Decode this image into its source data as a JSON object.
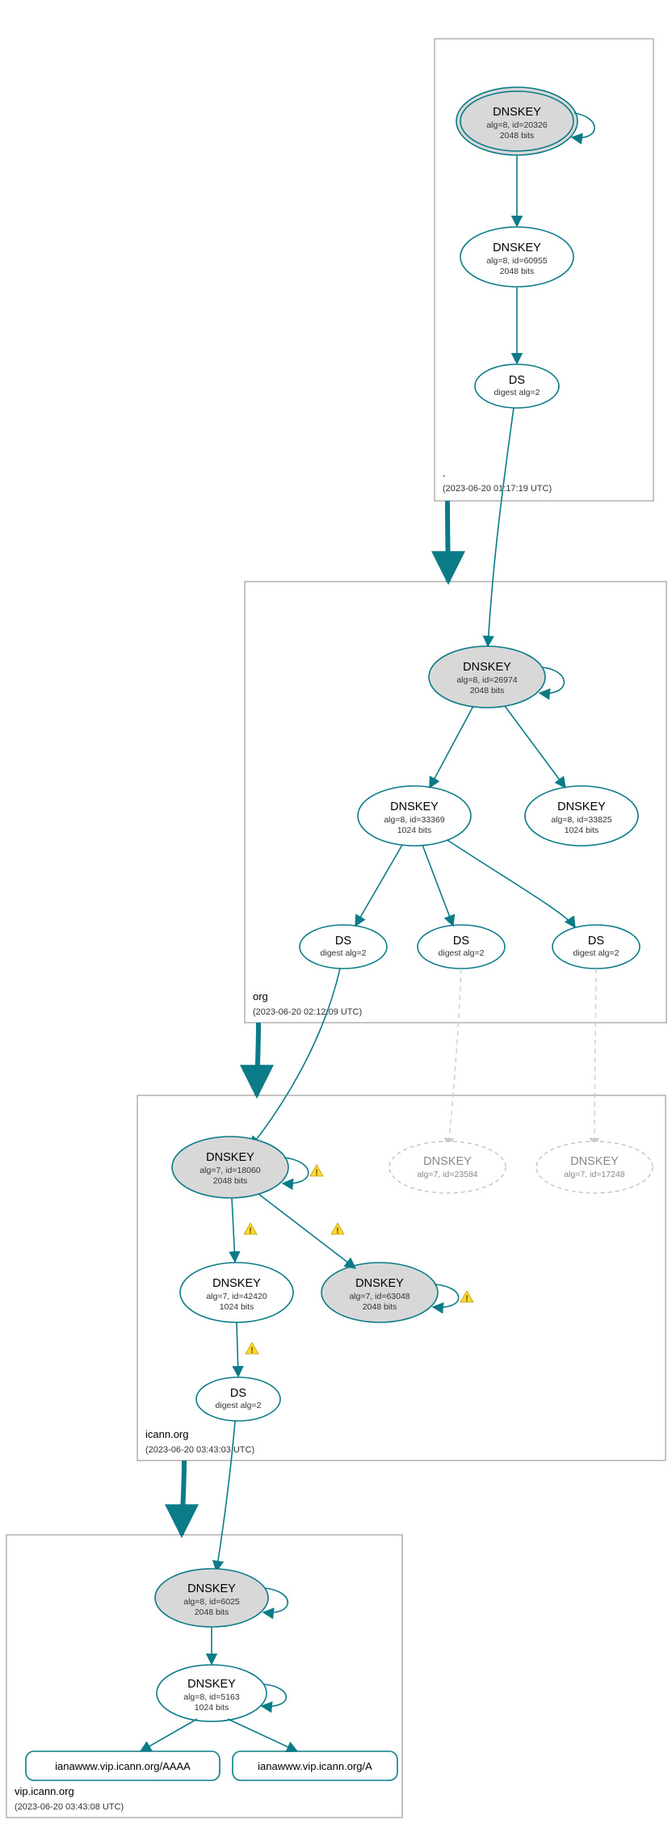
{
  "diagram_type": "DNSSEC authentication chain",
  "zones": {
    "root": {
      "label": ".",
      "timestamp": "(2023-06-20 01:17:19 UTC)",
      "nodes": {
        "ksk": {
          "title": "DNSKEY",
          "line2": "alg=8, id=20326",
          "line3": "2048 bits"
        },
        "zsk": {
          "title": "DNSKEY",
          "line2": "alg=8, id=60955",
          "line3": "2048 bits"
        },
        "ds_org": {
          "title": "DS",
          "line2": "digest alg=2"
        }
      }
    },
    "org": {
      "label": "org",
      "timestamp": "(2023-06-20 02:12:09 UTC)",
      "nodes": {
        "ksk": {
          "title": "DNSKEY",
          "line2": "alg=8, id=26974",
          "line3": "2048 bits"
        },
        "zsk1": {
          "title": "DNSKEY",
          "line2": "alg=8, id=33369",
          "line3": "1024 bits"
        },
        "zsk2": {
          "title": "DNSKEY",
          "line2": "alg=8, id=33825",
          "line3": "1024 bits"
        },
        "ds1": {
          "title": "DS",
          "line2": "digest alg=2"
        },
        "ds2": {
          "title": "DS",
          "line2": "digest alg=2"
        },
        "ds3": {
          "title": "DS",
          "line2": "digest alg=2"
        }
      }
    },
    "icann": {
      "label": "icann.org",
      "timestamp": "(2023-06-20 03:43:03 UTC)",
      "nodes": {
        "ksk": {
          "title": "DNSKEY",
          "line2": "alg=7, id=18060",
          "line3": "2048 bits"
        },
        "zsk1": {
          "title": "DNSKEY",
          "line2": "alg=7, id=42420",
          "line3": "1024 bits"
        },
        "zsk2": {
          "title": "DNSKEY",
          "line2": "alg=7, id=63048",
          "line3": "2048 bits"
        },
        "ghost1": {
          "title": "DNSKEY",
          "line2": "alg=7, id=23584"
        },
        "ghost2": {
          "title": "DNSKEY",
          "line2": "alg=7, id=17248"
        },
        "ds": {
          "title": "DS",
          "line2": "digest alg=2"
        }
      }
    },
    "vip": {
      "label": "vip.icann.org",
      "timestamp": "(2023-06-20 03:43:08 UTC)",
      "nodes": {
        "ksk": {
          "title": "DNSKEY",
          "line2": "alg=8, id=6025",
          "line3": "2048 bits"
        },
        "zsk": {
          "title": "DNSKEY",
          "line2": "alg=8, id=5163",
          "line3": "1024 bits"
        },
        "rrA": {
          "label": "ianawww.vip.icann.org/A"
        },
        "rrAAAA": {
          "label": "ianawww.vip.icann.org/AAAA"
        }
      }
    }
  },
  "colors": {
    "edge": "#0a7b87",
    "node_fill_grey": "#d8d8d8",
    "node_fill_white": "#ffffff",
    "ghost": "#bbbbbb"
  }
}
